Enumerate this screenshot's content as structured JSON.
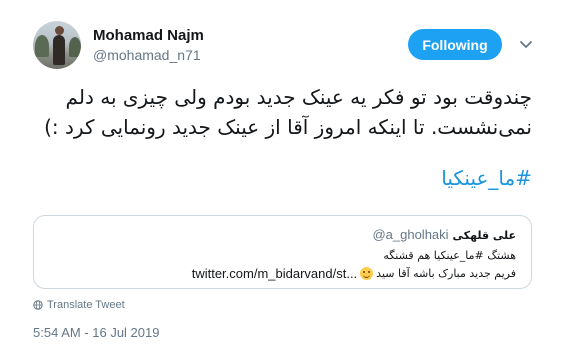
{
  "author": {
    "display_name": "Mohamad Najm",
    "username": "@mohamad_n71"
  },
  "follow_button": {
    "label": "Following",
    "color": "#1da1f2"
  },
  "tweet": {
    "text_lines": [
      "چندوقت بود تو فکر یه عینک جدید بودم ولی چیزی به دلم",
      "نمی‌نشست. تا اینکه امروز آقا از عینک جدید رونمایی کرد :)"
    ],
    "hashtag": "#ما_عینکیا",
    "hashtag_color": "#1b95e0"
  },
  "quoted_tweet": {
    "display_name": "علی قلهکی",
    "username": "@a_gholhaki",
    "line1": "هشتگ #ما_عینکیا هم قشنگه",
    "line2_text": "فریم جدید مبارک باشه آقا سید",
    "line2_link": "twitter.com/m_bidarvand/st...",
    "emoji": "winking-face-icon"
  },
  "translate_label": "Translate Tweet",
  "timestamp": "5:54 AM - 16 Jul 2019"
}
